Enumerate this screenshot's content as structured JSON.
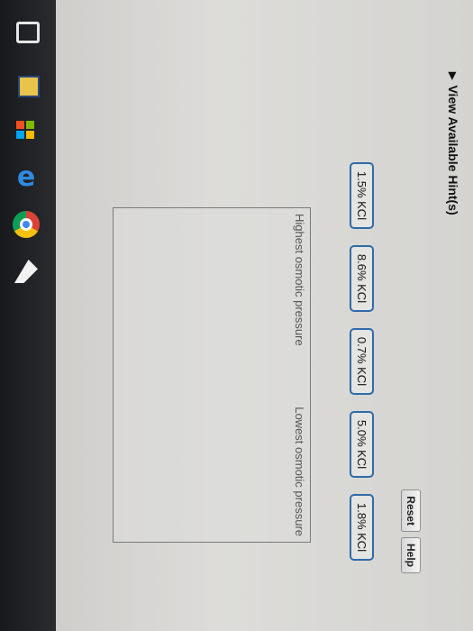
{
  "hints": {
    "label": "View Available Hint(s)"
  },
  "toolbar": {
    "reset_label": "Reset",
    "help_label": "Help"
  },
  "chips": [
    {
      "label": "1.5% KCl"
    },
    {
      "label": "8.6% KCl"
    },
    {
      "label": "0.7% KCl"
    },
    {
      "label": "5.0% KCl"
    },
    {
      "label": "1.8% KCl"
    }
  ],
  "drop_zone": {
    "left_label": "Highest osmotic pressure",
    "right_label": "Lowest osmotic pressure"
  },
  "colors": {
    "chip_border": "#2f6aa8",
    "taskbar": "#1c1d20"
  },
  "taskbar_icons": [
    "task-view-icon",
    "file-explorer-icon",
    "store-icon",
    "edge-icon",
    "chrome-icon",
    "pen-icon"
  ]
}
